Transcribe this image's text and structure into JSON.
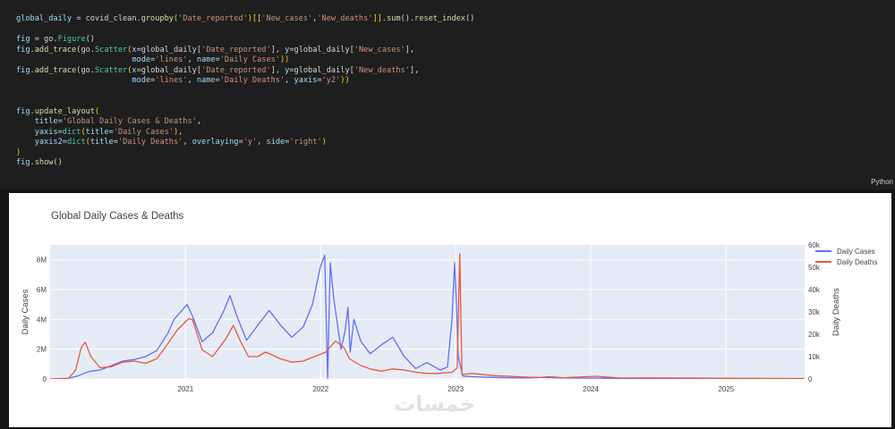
{
  "code_lines": [
    [
      [
        "global_daily",
        "var"
      ],
      [
        " = covid_clean.",
        "pun"
      ],
      [
        "groupby",
        "fn"
      ],
      [
        "(",
        "brk"
      ],
      [
        "'Date_reported'",
        "str"
      ],
      [
        ")[[",
        "brk"
      ],
      [
        "'New_cases'",
        "str"
      ],
      [
        ",",
        "pun"
      ],
      [
        "'New_deaths'",
        "str"
      ],
      [
        "]].",
        "brk"
      ],
      [
        "sum",
        "fn"
      ],
      [
        "().",
        "pun"
      ],
      [
        "reset_index",
        "fn"
      ],
      [
        "()",
        "pun"
      ]
    ],
    [],
    [
      [
        "fig",
        "var"
      ],
      [
        " = go.",
        "pun"
      ],
      [
        "Figure",
        "cls"
      ],
      [
        "()",
        "pun"
      ]
    ],
    [
      [
        "fig",
        "var"
      ],
      [
        ".",
        "pun"
      ],
      [
        "add_trace",
        "fn"
      ],
      [
        "(go.",
        "pun"
      ],
      [
        "Scatter",
        "cls"
      ],
      [
        "(",
        "brk"
      ],
      [
        "x",
        "var"
      ],
      [
        "=global_daily[",
        "pun"
      ],
      [
        "'Date_reported'",
        "str"
      ],
      [
        "], ",
        "pun"
      ],
      [
        "y",
        "var"
      ],
      [
        "=global_daily[",
        "pun"
      ],
      [
        "'New_cases'",
        "str"
      ],
      [
        "],",
        "pun"
      ]
    ],
    [
      [
        "                         ",
        "pun"
      ],
      [
        "mode",
        "var"
      ],
      [
        "=",
        "pun"
      ],
      [
        "'lines'",
        "str"
      ],
      [
        ", ",
        "pun"
      ],
      [
        "name",
        "var"
      ],
      [
        "=",
        "pun"
      ],
      [
        "'Daily Cases'",
        "str"
      ],
      [
        "))",
        "brk"
      ]
    ],
    [
      [
        "fig",
        "var"
      ],
      [
        ".",
        "pun"
      ],
      [
        "add_trace",
        "fn"
      ],
      [
        "(go.",
        "pun"
      ],
      [
        "Scatter",
        "cls"
      ],
      [
        "(",
        "brk"
      ],
      [
        "x",
        "var"
      ],
      [
        "=global_daily[",
        "pun"
      ],
      [
        "'Date_reported'",
        "str"
      ],
      [
        "], ",
        "pun"
      ],
      [
        "y",
        "var"
      ],
      [
        "=global_daily[",
        "pun"
      ],
      [
        "'New_deaths'",
        "str"
      ],
      [
        "],",
        "pun"
      ]
    ],
    [
      [
        "                         ",
        "pun"
      ],
      [
        "mode",
        "var"
      ],
      [
        "=",
        "pun"
      ],
      [
        "'lines'",
        "str"
      ],
      [
        ", ",
        "pun"
      ],
      [
        "name",
        "var"
      ],
      [
        "=",
        "pun"
      ],
      [
        "'Daily Deaths'",
        "str"
      ],
      [
        ", ",
        "pun"
      ],
      [
        "yaxis",
        "var"
      ],
      [
        "=",
        "pun"
      ],
      [
        "'y2'",
        "str"
      ],
      [
        "))",
        "brk"
      ]
    ],
    [],
    [],
    [
      [
        "fig",
        "var"
      ],
      [
        ".",
        "pun"
      ],
      [
        "update_layout",
        "fn"
      ],
      [
        "(",
        "brk"
      ]
    ],
    [
      [
        "    ",
        "pun"
      ],
      [
        "title",
        "var"
      ],
      [
        "=",
        "pun"
      ],
      [
        "'Global Daily Cases & Deaths'",
        "str"
      ],
      [
        ",",
        "pun"
      ]
    ],
    [
      [
        "    ",
        "pun"
      ],
      [
        "yaxis",
        "var"
      ],
      [
        "=",
        "pun"
      ],
      [
        "dict",
        "cls"
      ],
      [
        "(",
        "brk"
      ],
      [
        "title",
        "var"
      ],
      [
        "=",
        "pun"
      ],
      [
        "'Daily Cases'",
        "str"
      ],
      [
        "),",
        "brk"
      ]
    ],
    [
      [
        "    ",
        "pun"
      ],
      [
        "yaxis2",
        "var"
      ],
      [
        "=",
        "pun"
      ],
      [
        "dict",
        "cls"
      ],
      [
        "(",
        "brk"
      ],
      [
        "title",
        "var"
      ],
      [
        "=",
        "pun"
      ],
      [
        "'Daily Deaths'",
        "str"
      ],
      [
        ", ",
        "pun"
      ],
      [
        "overlaying",
        "var"
      ],
      [
        "=",
        "pun"
      ],
      [
        "'y'",
        "str"
      ],
      [
        ", ",
        "pun"
      ],
      [
        "side",
        "var"
      ],
      [
        "=",
        "pun"
      ],
      [
        "'right'",
        "str"
      ],
      [
        ")",
        "brk"
      ]
    ],
    [
      [
        ")",
        "brk"
      ]
    ],
    [
      [
        "fig",
        "var"
      ],
      [
        ".",
        "pun"
      ],
      [
        "show",
        "fn"
      ],
      [
        "()",
        "pun"
      ]
    ]
  ],
  "cell_language": "Python",
  "watermark_text": "خمسات",
  "chart_data": {
    "type": "line",
    "title": "Global Daily Cases & Deaths",
    "ylabel": "Daily Cases",
    "y2label": "Daily Deaths",
    "ylim": [
      0,
      9000000
    ],
    "y2lim": [
      0,
      60000
    ],
    "xlim": [
      "2020-01-01",
      "2025-08-01"
    ],
    "y_ticks": [
      {
        "v": 0,
        "t": "0"
      },
      {
        "v": 2000000,
        "t": "2M"
      },
      {
        "v": 4000000,
        "t": "4M"
      },
      {
        "v": 6000000,
        "t": "6M"
      },
      {
        "v": 8000000,
        "t": "8M"
      }
    ],
    "y2_ticks": [
      {
        "v": 0,
        "t": "0"
      },
      {
        "v": 10000,
        "t": "10k"
      },
      {
        "v": 20000,
        "t": "20k"
      },
      {
        "v": 30000,
        "t": "30k"
      },
      {
        "v": 40000,
        "t": "40k"
      },
      {
        "v": 50000,
        "t": "50k"
      },
      {
        "v": 60000,
        "t": "60k"
      }
    ],
    "x_ticks": [
      {
        "v": "2021-01-01",
        "t": "2021"
      },
      {
        "v": "2022-01-01",
        "t": "2022"
      },
      {
        "v": "2023-01-01",
        "t": "2023"
      },
      {
        "v": "2024-01-01",
        "t": "2024"
      },
      {
        "v": "2025-01-01",
        "t": "2025"
      }
    ],
    "grid": true,
    "legend_position": "top-right",
    "series": [
      {
        "name": "Daily Cases",
        "axis": "y",
        "color": "#636efa",
        "points": [
          [
            "2020-01-01",
            0
          ],
          [
            "2020-02-15",
            20000
          ],
          [
            "2020-03-15",
            200000
          ],
          [
            "2020-04-15",
            500000
          ],
          [
            "2020-05-15",
            600000
          ],
          [
            "2020-06-15",
            900000
          ],
          [
            "2020-07-15",
            1200000
          ],
          [
            "2020-08-15",
            1300000
          ],
          [
            "2020-09-15",
            1500000
          ],
          [
            "2020-10-15",
            1900000
          ],
          [
            "2020-11-15",
            3100000
          ],
          [
            "2020-12-01",
            4000000
          ],
          [
            "2020-12-15",
            4400000
          ],
          [
            "2021-01-05",
            5000000
          ],
          [
            "2021-01-20",
            4200000
          ],
          [
            "2021-02-15",
            2500000
          ],
          [
            "2021-03-15",
            3100000
          ],
          [
            "2021-04-15",
            4600000
          ],
          [
            "2021-05-01",
            5600000
          ],
          [
            "2021-05-20",
            4200000
          ],
          [
            "2021-06-15",
            2600000
          ],
          [
            "2021-07-15",
            3600000
          ],
          [
            "2021-08-15",
            4600000
          ],
          [
            "2021-09-15",
            3600000
          ],
          [
            "2021-10-15",
            2800000
          ],
          [
            "2021-11-15",
            3500000
          ],
          [
            "2021-12-10",
            5000000
          ],
          [
            "2021-12-31",
            7500000
          ],
          [
            "2022-01-12",
            8300000
          ],
          [
            "2022-01-20",
            20000
          ],
          [
            "2022-01-27",
            7800000
          ],
          [
            "2022-02-05",
            5500000
          ],
          [
            "2022-02-25",
            2000000
          ],
          [
            "2022-03-08",
            3200000
          ],
          [
            "2022-03-16",
            4800000
          ],
          [
            "2022-03-22",
            1800000
          ],
          [
            "2022-04-01",
            4000000
          ],
          [
            "2022-04-20",
            2500000
          ],
          [
            "2022-05-15",
            1700000
          ],
          [
            "2022-06-15",
            2300000
          ],
          [
            "2022-07-15",
            2800000
          ],
          [
            "2022-08-15",
            1500000
          ],
          [
            "2022-09-15",
            700000
          ],
          [
            "2022-10-15",
            1100000
          ],
          [
            "2022-11-20",
            600000
          ],
          [
            "2022-12-10",
            800000
          ],
          [
            "2022-12-22",
            4000000
          ],
          [
            "2022-12-29",
            7800000
          ],
          [
            "2023-01-03",
            5000000
          ],
          [
            "2023-01-08",
            1500000
          ],
          [
            "2023-01-20",
            200000
          ],
          [
            "2023-02-15",
            150000
          ],
          [
            "2023-04-15",
            100000
          ],
          [
            "2023-07-01",
            60000
          ],
          [
            "2023-08-20",
            100000
          ],
          [
            "2023-09-10",
            150000
          ],
          [
            "2023-11-01",
            60000
          ],
          [
            "2024-02-01",
            50000
          ],
          [
            "2025-07-31",
            15000
          ]
        ]
      },
      {
        "name": "Daily Deaths",
        "axis": "y2",
        "color": "#ef553b",
        "points": [
          [
            "2020-01-01",
            0
          ],
          [
            "2020-02-20",
            300
          ],
          [
            "2020-03-10",
            4000
          ],
          [
            "2020-03-25",
            14000
          ],
          [
            "2020-04-05",
            16500
          ],
          [
            "2020-04-20",
            10000
          ],
          [
            "2020-05-15",
            5000
          ],
          [
            "2020-06-15",
            5500
          ],
          [
            "2020-07-15",
            7500
          ],
          [
            "2020-08-15",
            8000
          ],
          [
            "2020-09-15",
            7000
          ],
          [
            "2020-10-15",
            9000
          ],
          [
            "2020-11-15",
            16000
          ],
          [
            "2020-12-10",
            22000
          ],
          [
            "2021-01-10",
            27000
          ],
          [
            "2021-01-20",
            26500
          ],
          [
            "2021-02-15",
            13000
          ],
          [
            "2021-03-15",
            10000
          ],
          [
            "2021-04-20",
            18000
          ],
          [
            "2021-05-10",
            24000
          ],
          [
            "2021-06-01",
            16000
          ],
          [
            "2021-06-20",
            10000
          ],
          [
            "2021-07-15",
            10000
          ],
          [
            "2021-08-05",
            12000
          ],
          [
            "2021-08-20",
            11000
          ],
          [
            "2021-09-15",
            9000
          ],
          [
            "2021-10-15",
            7500
          ],
          [
            "2021-11-15",
            8000
          ],
          [
            "2021-12-15",
            10000
          ],
          [
            "2022-01-15",
            12000
          ],
          [
            "2022-02-10",
            17000
          ],
          [
            "2022-03-05",
            14000
          ],
          [
            "2022-03-20",
            9000
          ],
          [
            "2022-04-20",
            6000
          ],
          [
            "2022-05-15",
            4500
          ],
          [
            "2022-06-15",
            3500
          ],
          [
            "2022-07-15",
            4500
          ],
          [
            "2022-08-15",
            4000
          ],
          [
            "2022-09-15",
            3000
          ],
          [
            "2022-10-15",
            2500
          ],
          [
            "2022-11-15",
            2500
          ],
          [
            "2022-12-22",
            3000
          ],
          [
            "2023-01-05",
            5000
          ],
          [
            "2023-01-12",
            56000
          ],
          [
            "2023-01-18",
            2000
          ],
          [
            "2023-02-15",
            2500
          ],
          [
            "2023-04-15",
            1500
          ],
          [
            "2023-07-15",
            800
          ],
          [
            "2023-10-15",
            500
          ],
          [
            "2024-01-15",
            1200
          ],
          [
            "2024-03-15",
            500
          ],
          [
            "2025-07-31",
            200
          ]
        ]
      }
    ]
  }
}
